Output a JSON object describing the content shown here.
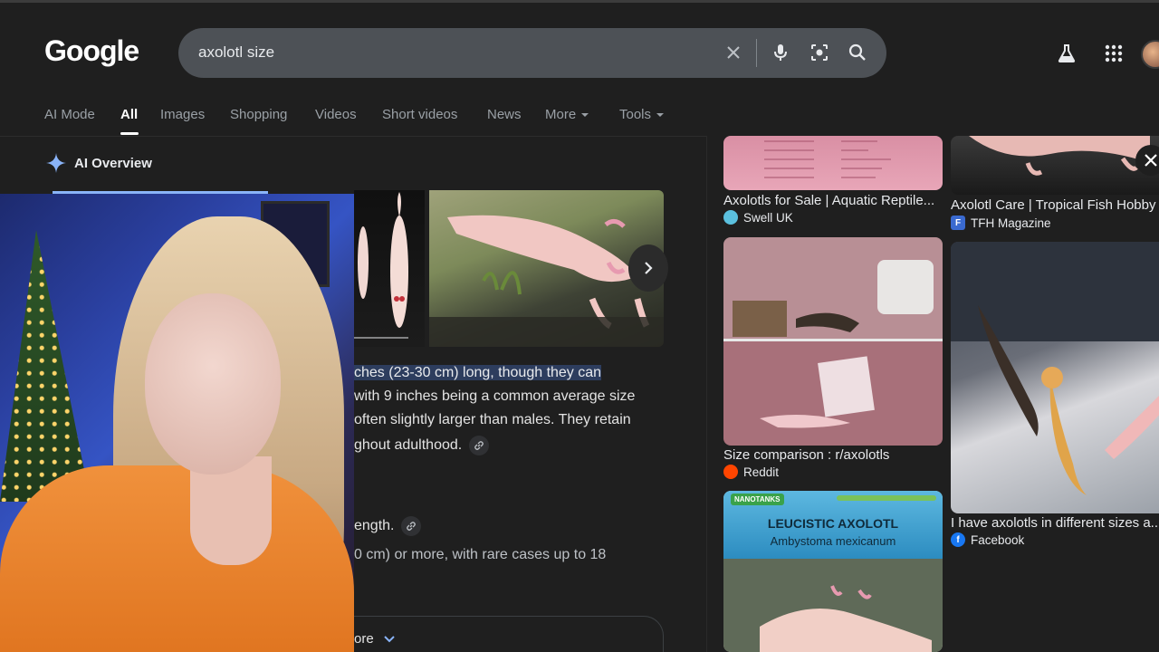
{
  "header": {
    "logo": "Google",
    "search_value": "axolotl size"
  },
  "tabs": [
    {
      "label": "AI Mode"
    },
    {
      "label": "All"
    },
    {
      "label": "Images"
    },
    {
      "label": "Shopping"
    },
    {
      "label": "Videos"
    },
    {
      "label": "Short videos"
    },
    {
      "label": "News"
    },
    {
      "label": "More"
    },
    {
      "label": "Tools"
    }
  ],
  "ai_overview": {
    "title": "AI Overview",
    "line1": "ches (23-30 cm) long, though they can",
    "line2": "with 9 inches being a common average size",
    "line3": "often slightly larger than males. They retain",
    "line4": "ghout adulthood.",
    "line5": "ength.",
    "line6": "0 cm) or more, with rare cases up to 18",
    "more_label": "ore"
  },
  "images": [
    {
      "caption": "Axolotls for Sale | Aquatic Reptile...",
      "source": "Swell UK",
      "source_icon": "swell-icon"
    },
    {
      "caption": "Axolotl Care | Tropical Fish Hobby",
      "source": "TFH Magazine",
      "source_icon": "tfh-icon"
    },
    {
      "caption": "Size comparison : r/axolotls",
      "source": "Reddit",
      "source_icon": "reddit-icon"
    },
    {
      "caption": "I have axolotls in different sizes a...",
      "source": "Facebook",
      "source_icon": "facebook-icon"
    },
    {
      "caption": "",
      "source": "",
      "overlay_title": "LEUCISTIC AXOLOTL",
      "overlay_subtitle": "Ambystoma mexicanum",
      "overlay_brand": "NANOTANKS"
    }
  ],
  "colors": {
    "background": "#1f1f1f",
    "search_bg": "#4d5156",
    "accent_blue": "#8ab4f8",
    "highlight": "#2d3d5e",
    "reddit": "#ff4500",
    "facebook": "#1877f2"
  }
}
